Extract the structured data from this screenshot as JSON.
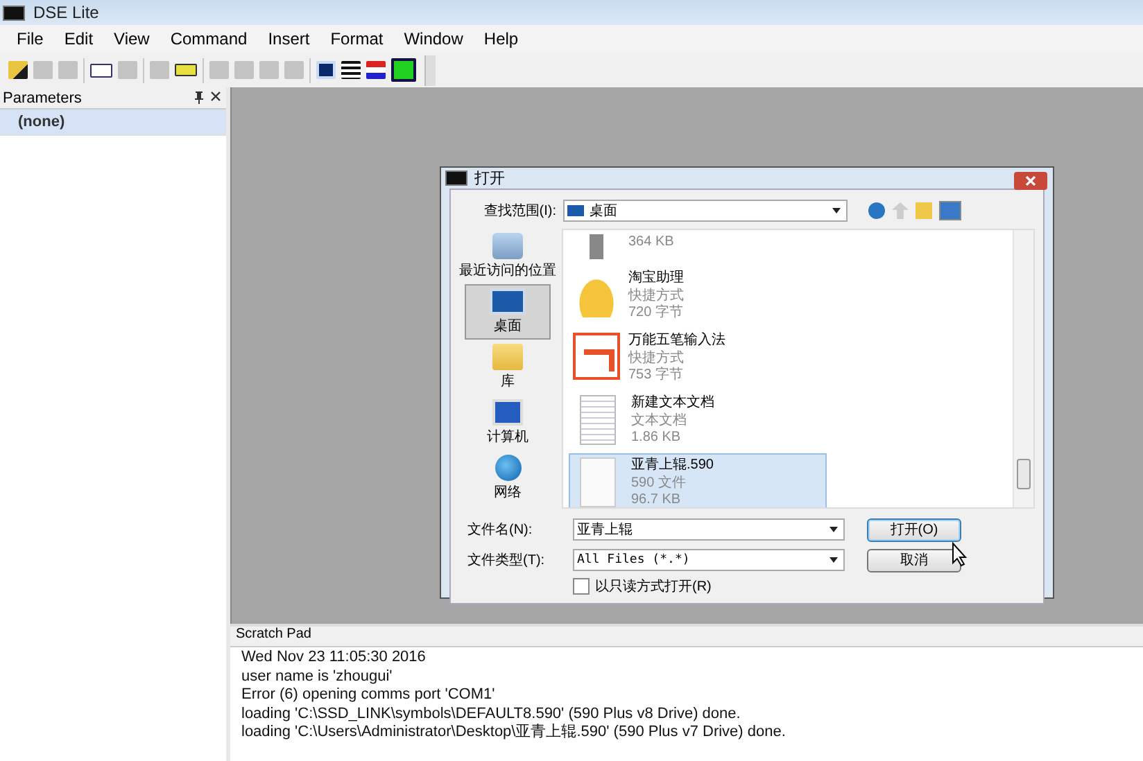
{
  "window": {
    "title": "DSE Lite"
  },
  "menu": [
    "File",
    "Edit",
    "View",
    "Command",
    "Insert",
    "Format",
    "Window",
    "Help"
  ],
  "parameters": {
    "title": "Parameters",
    "items": [
      {
        "label": "(none)",
        "selected": true
      }
    ]
  },
  "dialog": {
    "title": "打开",
    "look_in": {
      "label": "查找范围(I):",
      "value": "桌面"
    },
    "places": [
      {
        "label": "最近访问的位置",
        "kind": "recent",
        "selected": false
      },
      {
        "label": "桌面",
        "kind": "desktop",
        "selected": true
      },
      {
        "label": "库",
        "kind": "library",
        "selected": false
      },
      {
        "label": "计算机",
        "kind": "computer",
        "selected": false
      },
      {
        "label": "网络",
        "kind": "network",
        "selected": false
      }
    ],
    "files": [
      {
        "size": "364 KB",
        "kind": "device",
        "selected": false
      },
      {
        "name": "淘宝助理",
        "type": "快捷方式",
        "size": "720 字节",
        "kind": "hat",
        "selected": false
      },
      {
        "name": "万能五笔输入法",
        "type": "快捷方式",
        "size": "753 字节",
        "kind": "wubi",
        "selected": false
      },
      {
        "name": "新建文本文档",
        "type": "文本文档",
        "size": "1.86 KB",
        "kind": "text",
        "selected": false
      },
      {
        "name": "亚青上辊.590",
        "type": "590 文件",
        "size": "96.7 KB",
        "kind": "blank",
        "selected": true
      }
    ],
    "file_name": {
      "label": "文件名(N):",
      "value": "亚青上辊"
    },
    "file_type": {
      "label": "文件类型(T):",
      "value": "All Files (*.*)"
    },
    "readonly": {
      "label": "以只读方式打开(R)",
      "checked": false
    },
    "buttons": [
      {
        "label": "打开(O)",
        "default": true
      },
      {
        "label": "取消",
        "default": false
      }
    ]
  },
  "scratch_pad": {
    "title": "Scratch Pad",
    "lines": [
      "Wed Nov 23 11:05:30 2016",
      "user name is 'zhougui'",
      "Error (6) opening comms port 'COM1'",
      "loading 'C:\\SSD_LINK\\symbols\\DEFAULT8.590' (590 Plus v8 Drive) done.",
      "loading 'C:\\Users\\Administrator\\Desktop\\亚青上辊.590' (590 Plus v7 Drive) done."
    ]
  }
}
